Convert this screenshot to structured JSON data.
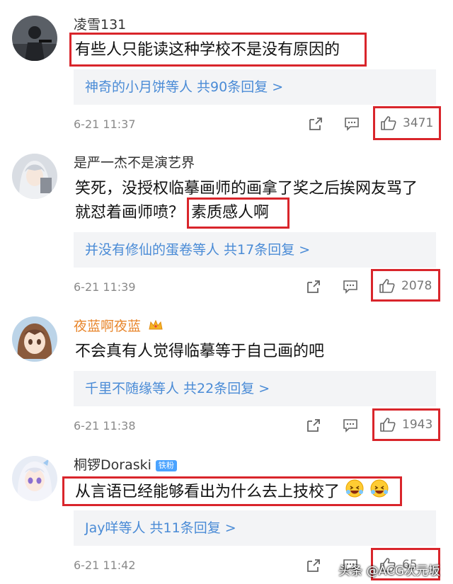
{
  "comments": [
    {
      "username": "凌雪131",
      "text": "有些人只能读这种学校不是没有原因的",
      "replies": "神奇的小月饼等人  共90条回复 >",
      "time": "6-21 11:37",
      "likes": "3471"
    },
    {
      "username": "是严一杰不是演艺界",
      "text_line1": "笑死，没授权临摹画师的画拿了奖之后挨网友骂了",
      "text_line2": "就怼着画师喷？",
      "text_highlight": "素质感人啊",
      "replies": "并没有修仙的蛋卷等人  共17条回复 >",
      "time": "6-21 11:39",
      "likes": "2078"
    },
    {
      "username": "夜蓝啊夜蓝",
      "text": "不会真有人觉得临摹等于自己画的吧",
      "replies": "千里不随缘等人  共22条回复 >",
      "time": "6-21 11:38",
      "likes": "1943"
    },
    {
      "username": "桐锣Doraski",
      "badge": "铁粉",
      "text": "从言语已经能够看出为什么去上技校了",
      "replies": "Jay咩等人  共11条回复 >",
      "time": "6-21 11:42",
      "likes": "65"
    }
  ],
  "watermark": "头条 @ACG次元坂",
  "colors": {
    "highlight_border": "#d9252b",
    "link_blue": "#4a8bd6",
    "vip_orange": "#e8862c",
    "reply_bg": "#f3f4f6"
  }
}
